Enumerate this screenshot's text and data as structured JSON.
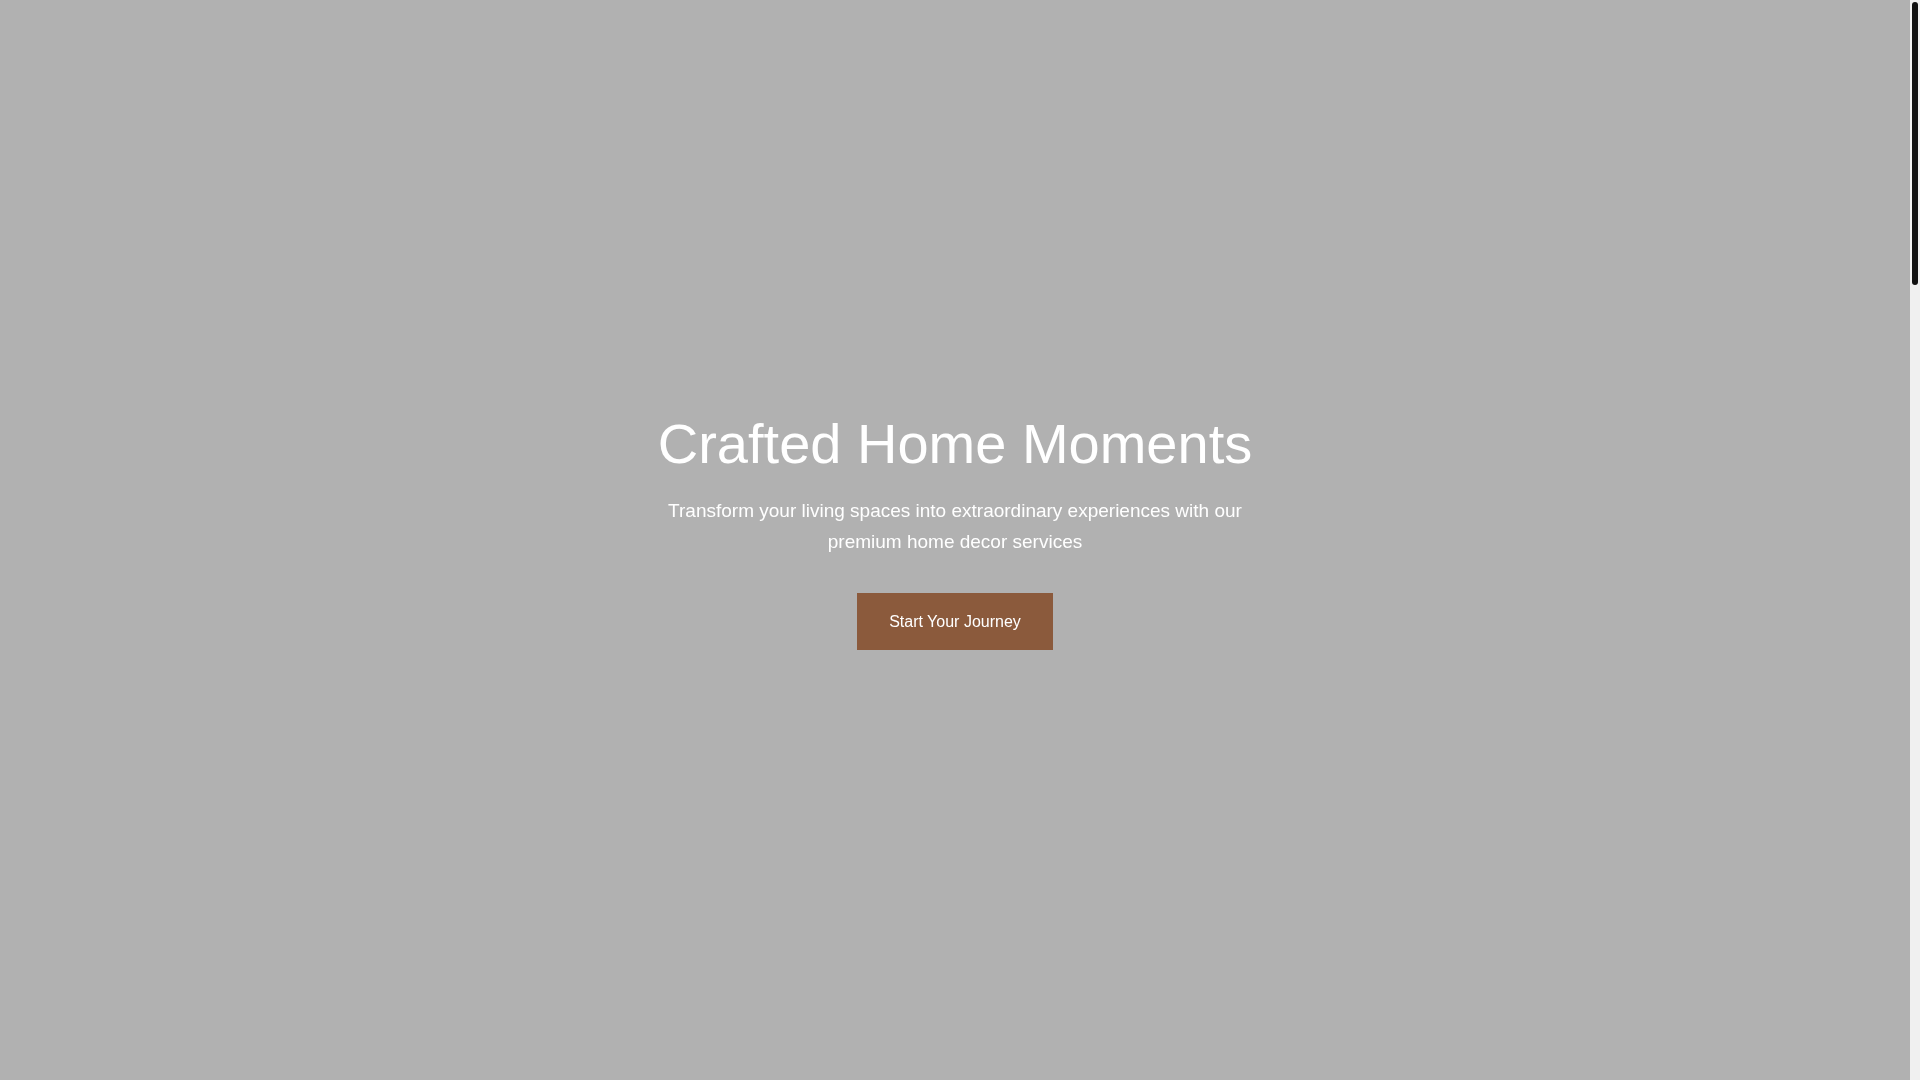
{
  "hero": {
    "title": "Crafted Home Moments",
    "subtitle": "Transform your living spaces into extraordinary experiences with our premium home decor services",
    "button": "Start Your Journey"
  }
}
